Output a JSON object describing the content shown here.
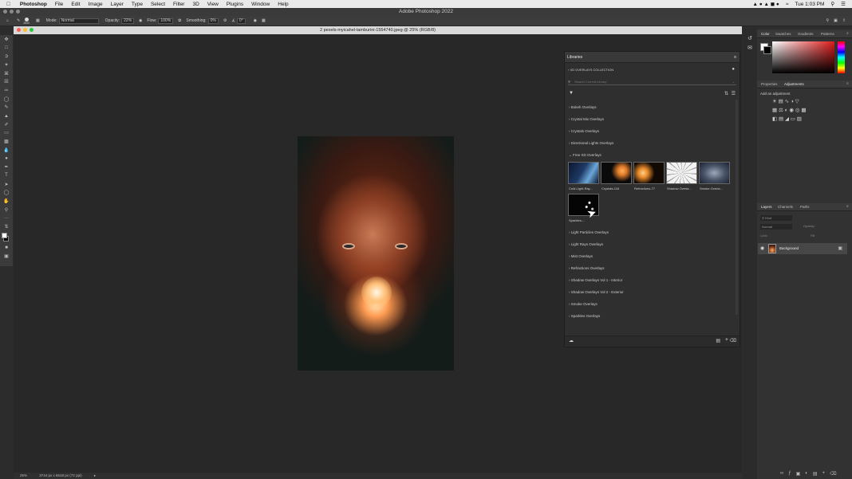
{
  "menubar": {
    "app": "Photoshop",
    "menus": [
      "File",
      "Edit",
      "Image",
      "Layer",
      "Type",
      "Select",
      "Filter",
      "3D",
      "View",
      "Plugins",
      "Window",
      "Help"
    ],
    "clock": "Tue 1:03 PM"
  },
  "app_title": "Adobe Photoshop 2022",
  "options": {
    "brush_size": "2840",
    "mode_label": "Mode:",
    "mode_value": "Normal",
    "opacity_label": "Opacity:",
    "opacity_value": "22%",
    "flow_label": "Flow:",
    "flow_value": "100%",
    "smoothing_label": "Smoothing:",
    "smoothing_value": "0%",
    "angle_value": "0°"
  },
  "document": {
    "tab_title": "2 pexels-myicahel-tamburini-1554740.jpeg @ 25% (RGB/8)",
    "zoom": "25%",
    "dimensions": "3744 px x 6618 px (72 ppi)"
  },
  "libraries": {
    "title": "Libraries",
    "collection": "XD OVERLAYS COLLECTION",
    "search_placeholder": "Search Current Library",
    "sections": [
      "Bokeh Overlays",
      "Crystal Mix Overlays",
      "Crystals Overlays",
      "Directional Lights Overlays",
      "Free XD Overlays",
      "Light Particles Overlays",
      "Light Rays Overlays",
      "Mist Overlays",
      "Refractions Overlays",
      "Shadow Overlays Vol 1 - Interior",
      "Shadow Overlays Vol 2 - Exterior",
      "Smoke Overlays",
      "Sparkles Overlays"
    ],
    "thumbnails": [
      {
        "label": "Cold-Light-Ray...",
        "color_a": "#0b1730",
        "color_b": "#6aa7d8"
      },
      {
        "label": "Crystals-116",
        "color_a": "#0a0a0a",
        "color_b": "#e07b2a"
      },
      {
        "label": "Refractions-77",
        "color_a": "#100904",
        "color_b": "#e88a2a"
      },
      {
        "label": "Shadow Overla...",
        "color_a": "#f2f2f2",
        "color_b": "#9a9a9a"
      },
      {
        "label": "Smoke-Overla...",
        "color_a": "#1b2230",
        "color_b": "#9ea8bb"
      },
      {
        "label": "Sparkles-...",
        "color_a": "#050505",
        "color_b": "#f5f5f5"
      }
    ]
  },
  "right_panels": {
    "color_tabs": [
      "Color",
      "Swatches",
      "Gradients",
      "Patterns"
    ],
    "adjust_tabs": [
      "Properties",
      "Adjustments"
    ],
    "add_adjustment": "Add an adjustment",
    "layers_tabs": [
      "Layers",
      "Channels",
      "Paths"
    ],
    "layer_kind": "Kind",
    "blend_mode": "Normal",
    "opacity_label": "Opacity:",
    "lock_label": "Lock:",
    "fill_label": "Fill:",
    "layer_name": "Background"
  },
  "colors": {
    "accent_gradient_red": "#e01b1b",
    "canvas_bg": "#282828"
  }
}
